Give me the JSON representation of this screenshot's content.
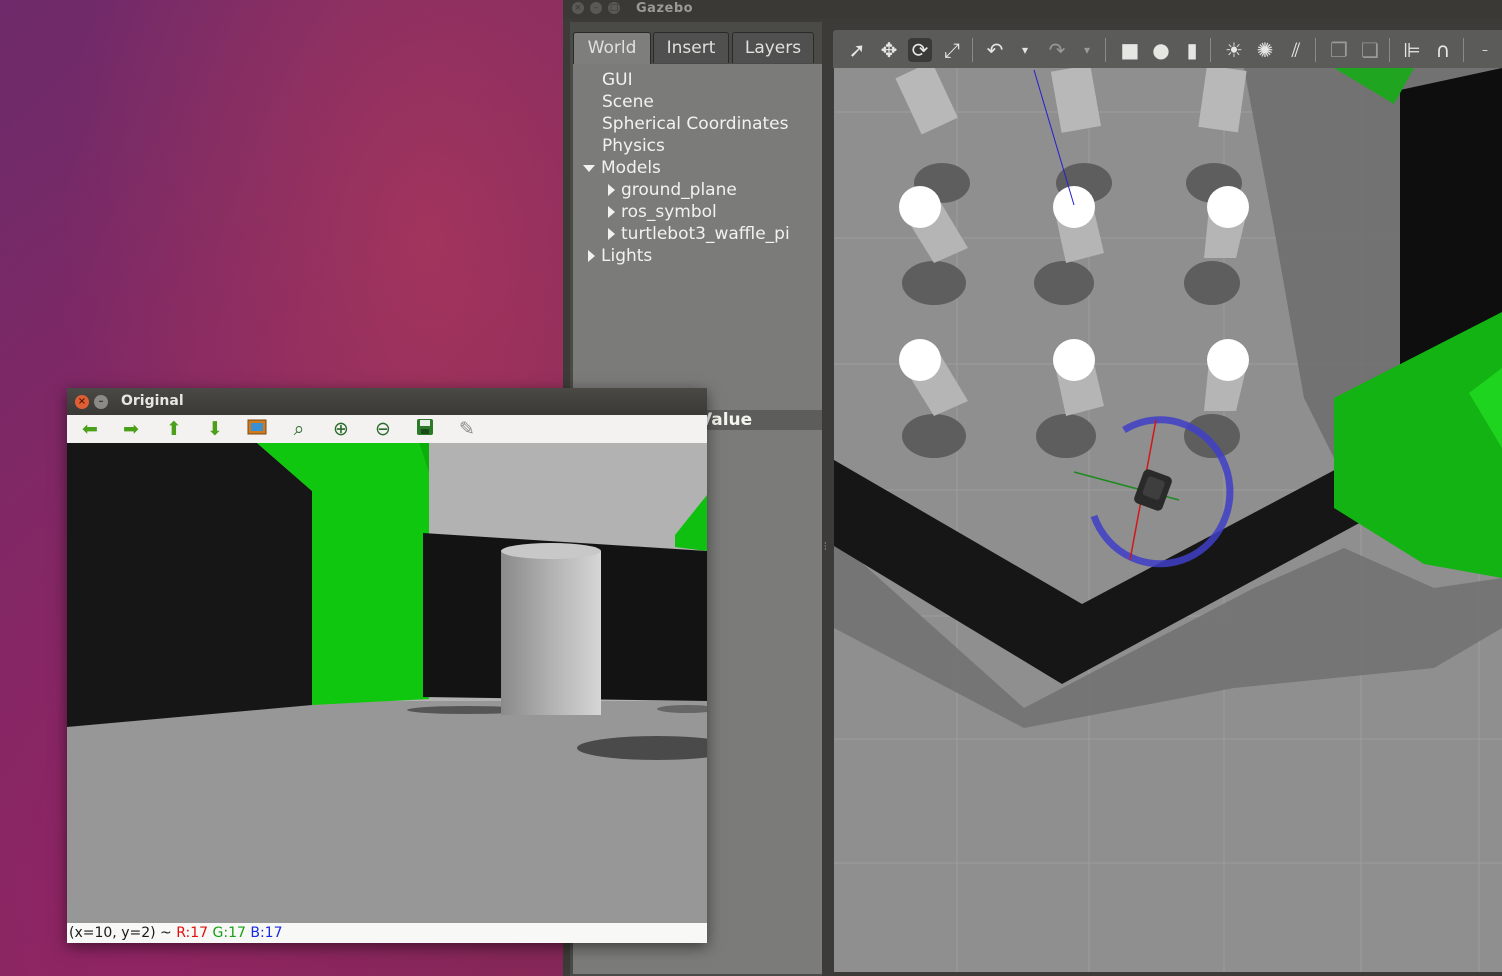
{
  "gazebo": {
    "title": "Gazebo",
    "tabs": [
      {
        "label": "World"
      },
      {
        "label": "Insert"
      },
      {
        "label": "Layers"
      }
    ],
    "tree": {
      "items": [
        {
          "label": "GUI"
        },
        {
          "label": "Scene"
        },
        {
          "label": "Spherical Coordinates"
        },
        {
          "label": "Physics"
        },
        {
          "label": "Models",
          "expanded": true
        },
        {
          "label": "ground_plane"
        },
        {
          "label": "ros_symbol"
        },
        {
          "label": "turtlebot3_waffle_pi"
        },
        {
          "label": "Lights",
          "expanded": false
        }
      ]
    },
    "properties": {
      "value_header": "Value"
    },
    "toolbar_icons": [
      "select-arrow-icon",
      "translate-icon",
      "rotate-icon",
      "scale-icon",
      "undo-icon",
      "undo-dropdown-icon",
      "redo-icon",
      "redo-dropdown-icon",
      "box-shape-icon",
      "sphere-shape-icon",
      "cylinder-shape-icon",
      "point-light-icon",
      "spot-light-icon",
      "directional-light-icon",
      "copy-icon",
      "paste-icon",
      "align-icon",
      "snap-icon"
    ]
  },
  "image_view": {
    "title": "Original",
    "toolbar_icons": [
      "left-arrow-icon",
      "right-arrow-icon",
      "up-arrow-icon",
      "down-arrow-icon",
      "image-icon",
      "zoom-fit-icon",
      "zoom-in-icon",
      "zoom-out-icon",
      "save-icon",
      "clear-brush-icon"
    ],
    "status": {
      "coord": "(x=10, y=2) ~",
      "r": "R:17",
      "g": "G:17",
      "b": "B:17"
    }
  },
  "colors": {
    "green": "#10d010",
    "wall": "#141414",
    "ring": "#3a3ac8"
  }
}
